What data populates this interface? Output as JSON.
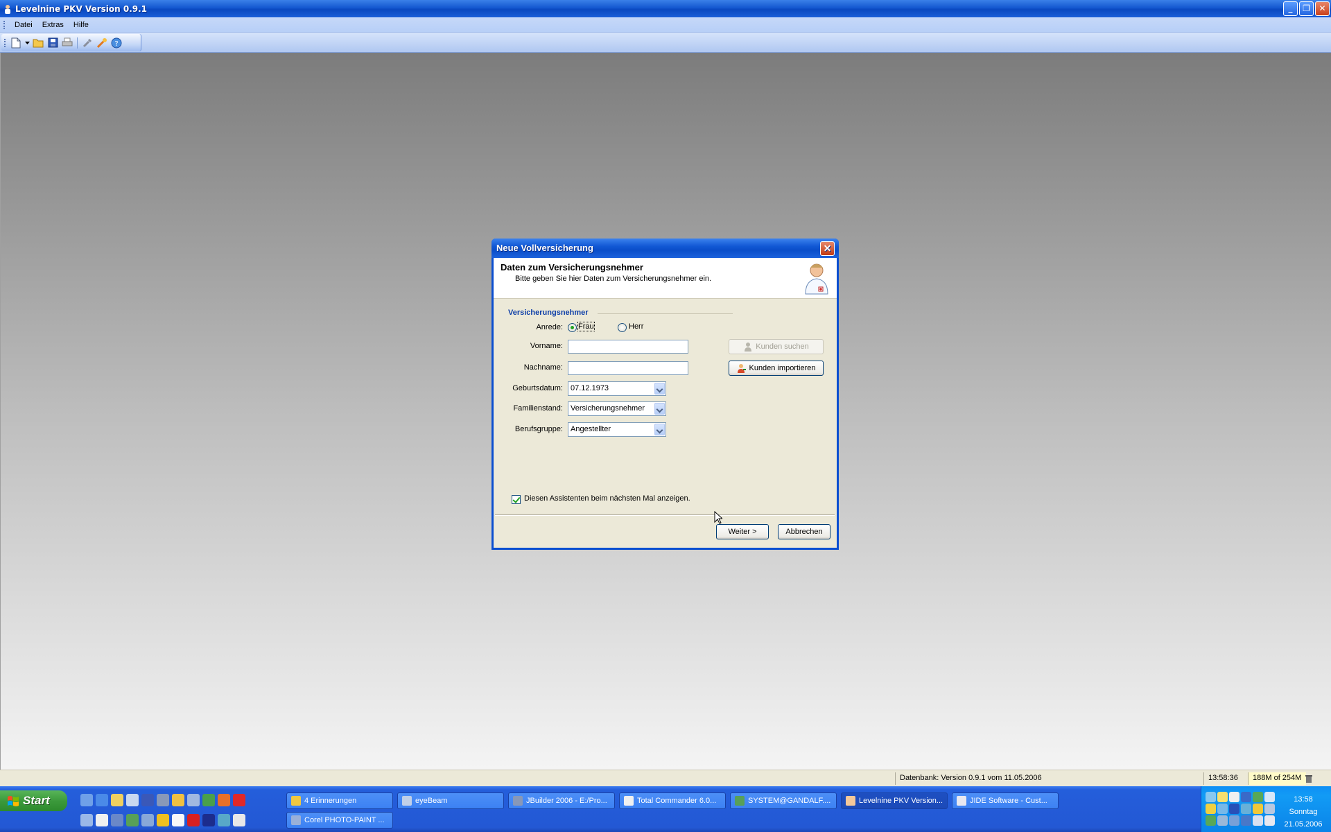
{
  "app": {
    "title": "Levelnine PKV Version 0.9.1",
    "window_buttons": {
      "minimize": "_",
      "restore": "❐",
      "close": "✕"
    }
  },
  "menu": {
    "items": [
      "Datei",
      "Extras",
      "Hilfe"
    ]
  },
  "toolbar": {
    "icons": [
      "new-document-icon",
      "dropdown-arrow-icon",
      "open-folder-icon",
      "save-icon",
      "print-icon",
      "tools-icon",
      "wizard-icon",
      "help-icon"
    ]
  },
  "dialog": {
    "title": "Neue Vollversicherung",
    "close": "✕",
    "header_title": "Daten zum Versicherungsnehmer",
    "header_subtitle": "Bitte geben Sie hier Daten zum Versicherungsnehmer ein.",
    "group_title": "Versicherungsnehmer",
    "anrede_label": "Anrede:",
    "anrede_options": [
      {
        "label": "Frau",
        "selected": true
      },
      {
        "label": "Herr",
        "selected": false
      }
    ],
    "vorname_label": "Vorname:",
    "vorname_value": "",
    "nachname_label": "Nachname:",
    "nachname_value": "",
    "geburtsdatum_label": "Geburtsdatum:",
    "geburtsdatum_value": "07.12.1973",
    "familienstand_label": "Familienstand:",
    "familienstand_value": "Versicherungsnehmer",
    "berufsgruppe_label": "Berufsgruppe:",
    "berufsgruppe_value": "Angestellter",
    "kunden_suchen": "Kunden suchen",
    "kunden_importieren": "Kunden importieren",
    "show_wizard_label": "Diesen Assistenten beim nächsten Mal anzeigen.",
    "show_wizard_checked": true,
    "weiter": "Weiter >",
    "abbrechen": "Abbrechen"
  },
  "statusbar": {
    "database": "Datenbank: Version 0.9.1 vom 11.05.2006",
    "time": "13:58:36",
    "memory": "188M of 254M"
  },
  "taskbar": {
    "start": "Start",
    "tasks_row1": [
      {
        "label": "4 Erinnerungen",
        "active": false
      },
      {
        "label": "eyeBeam",
        "active": false
      },
      {
        "label": "JBuilder 2006 - E:/Pro...",
        "active": false
      },
      {
        "label": "Total Commander 6.0...",
        "active": false
      },
      {
        "label": "SYSTEM@GANDALF....",
        "active": false
      },
      {
        "label": "Levelnine PKV Version...",
        "active": true
      },
      {
        "label": "JIDE Software - Cust...",
        "active": false
      }
    ],
    "tasks_row2": [
      {
        "label": "Corel PHOTO-PAINT ...",
        "active": false
      }
    ],
    "clock_time": "13:58",
    "clock_day": "Sonntag",
    "clock_date": "21.05.2006"
  },
  "colors": {
    "title_blue": "#0a4ec9",
    "dialog_bg": "#ece9d8",
    "group_title": "#0d3ea8",
    "taskbar": "#245edb",
    "start_green": "#3c9a3c"
  }
}
